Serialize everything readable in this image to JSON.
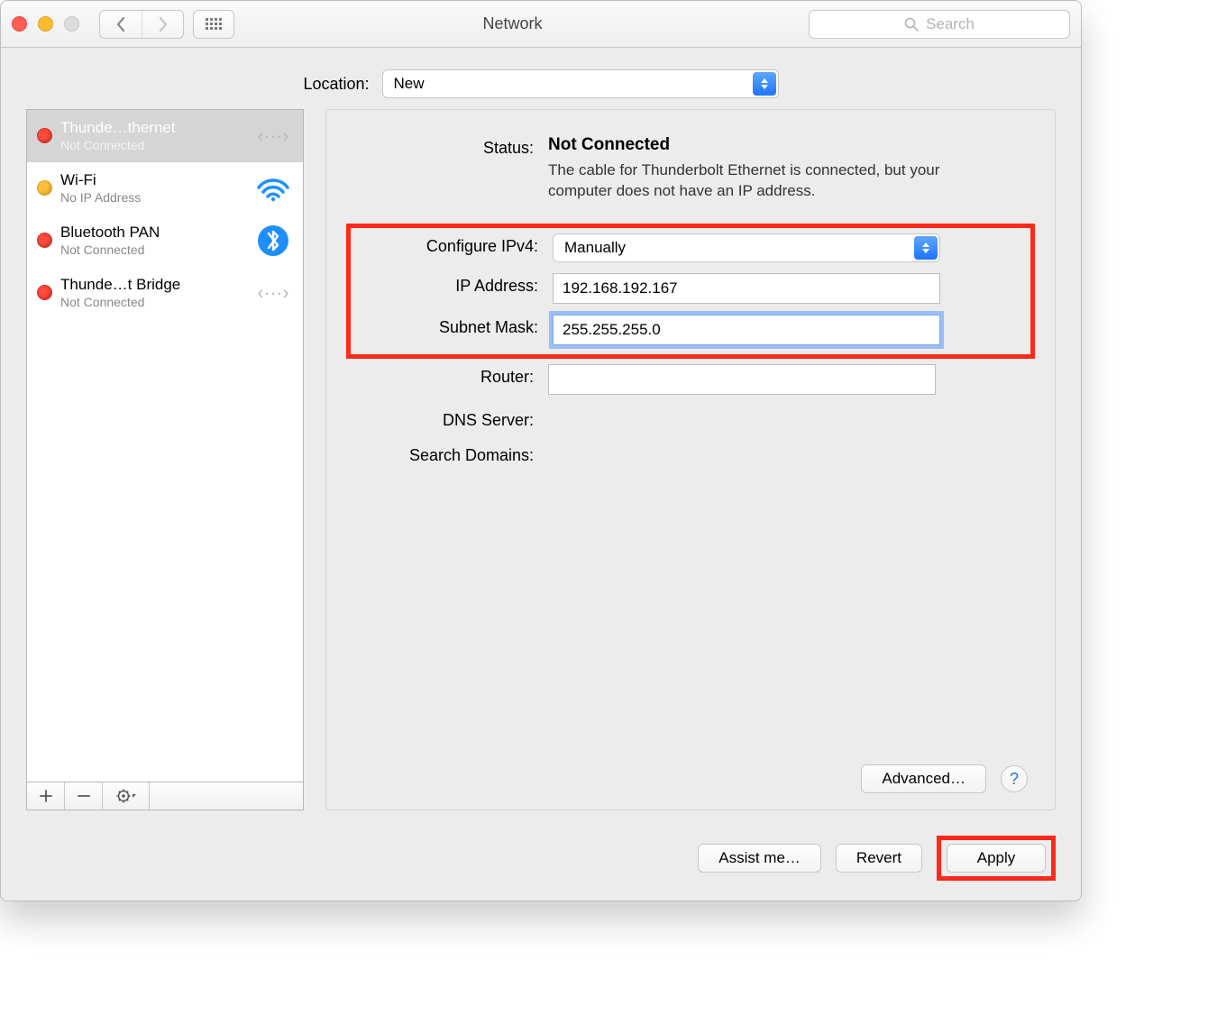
{
  "window": {
    "title": "Network"
  },
  "search": {
    "placeholder": "Search"
  },
  "location": {
    "label": "Location:",
    "value": "New"
  },
  "connections": [
    {
      "name": "Thunde…thernet",
      "status": "Not Connected",
      "dot": "red",
      "icon": "ethernet",
      "selected": true
    },
    {
      "name": "Wi-Fi",
      "status": "No IP Address",
      "dot": "orange",
      "icon": "wifi",
      "selected": false
    },
    {
      "name": "Bluetooth PAN",
      "status": "Not Connected",
      "dot": "red",
      "icon": "bluetooth",
      "selected": false
    },
    {
      "name": "Thunde…t Bridge",
      "status": "Not Connected",
      "dot": "red",
      "icon": "ethernet-light",
      "selected": false
    }
  ],
  "detail": {
    "status_label": "Status:",
    "status_value": "Not Connected",
    "status_desc": "The cable for Thunderbolt Ethernet is connected, but your computer does not have an IP address.",
    "ipv4_label": "Configure IPv4:",
    "ipv4_value": "Manually",
    "ip_label": "IP Address:",
    "ip_value": "192.168.192.167",
    "subnet_label": "Subnet Mask:",
    "subnet_value": "255.255.255.0",
    "router_label": "Router:",
    "router_value": "",
    "dns_label": "DNS Server:",
    "dns_value": "",
    "search_domains_label": "Search Domains:",
    "search_domains_value": "",
    "advanced_label": "Advanced…"
  },
  "buttons": {
    "assist": "Assist me…",
    "revert": "Revert",
    "apply": "Apply"
  }
}
